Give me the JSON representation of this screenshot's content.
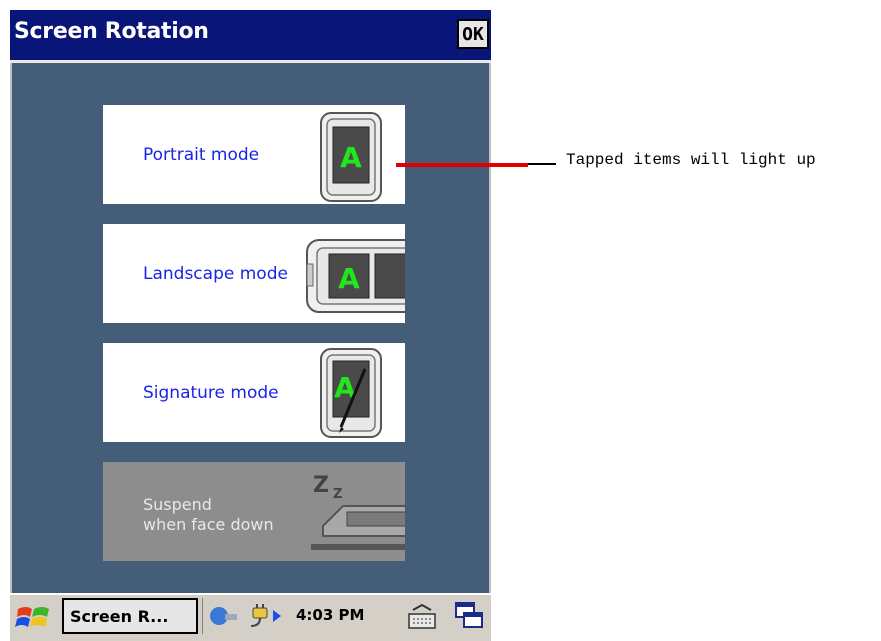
{
  "window": {
    "title": "Screen Rotation",
    "ok_label": "OK"
  },
  "modes": [
    {
      "label": "Portrait mode",
      "glyph": "A"
    },
    {
      "label": "Landscape mode",
      "glyph": "A"
    },
    {
      "label": "Signature mode",
      "glyph": "A"
    }
  ],
  "suspend": {
    "line1": "Suspend",
    "line2": "when face down",
    "zz": "Z"
  },
  "taskbar": {
    "task_label": "Screen R...",
    "clock": "4:03 PM"
  },
  "callout": {
    "text": "Tapped items will light up"
  },
  "colors": {
    "title_bar": "#0a157a",
    "content_bg": "#445d79",
    "mode_text": "#1a24e8",
    "glyph": "#22e61c",
    "callout_line": "#e00000"
  }
}
